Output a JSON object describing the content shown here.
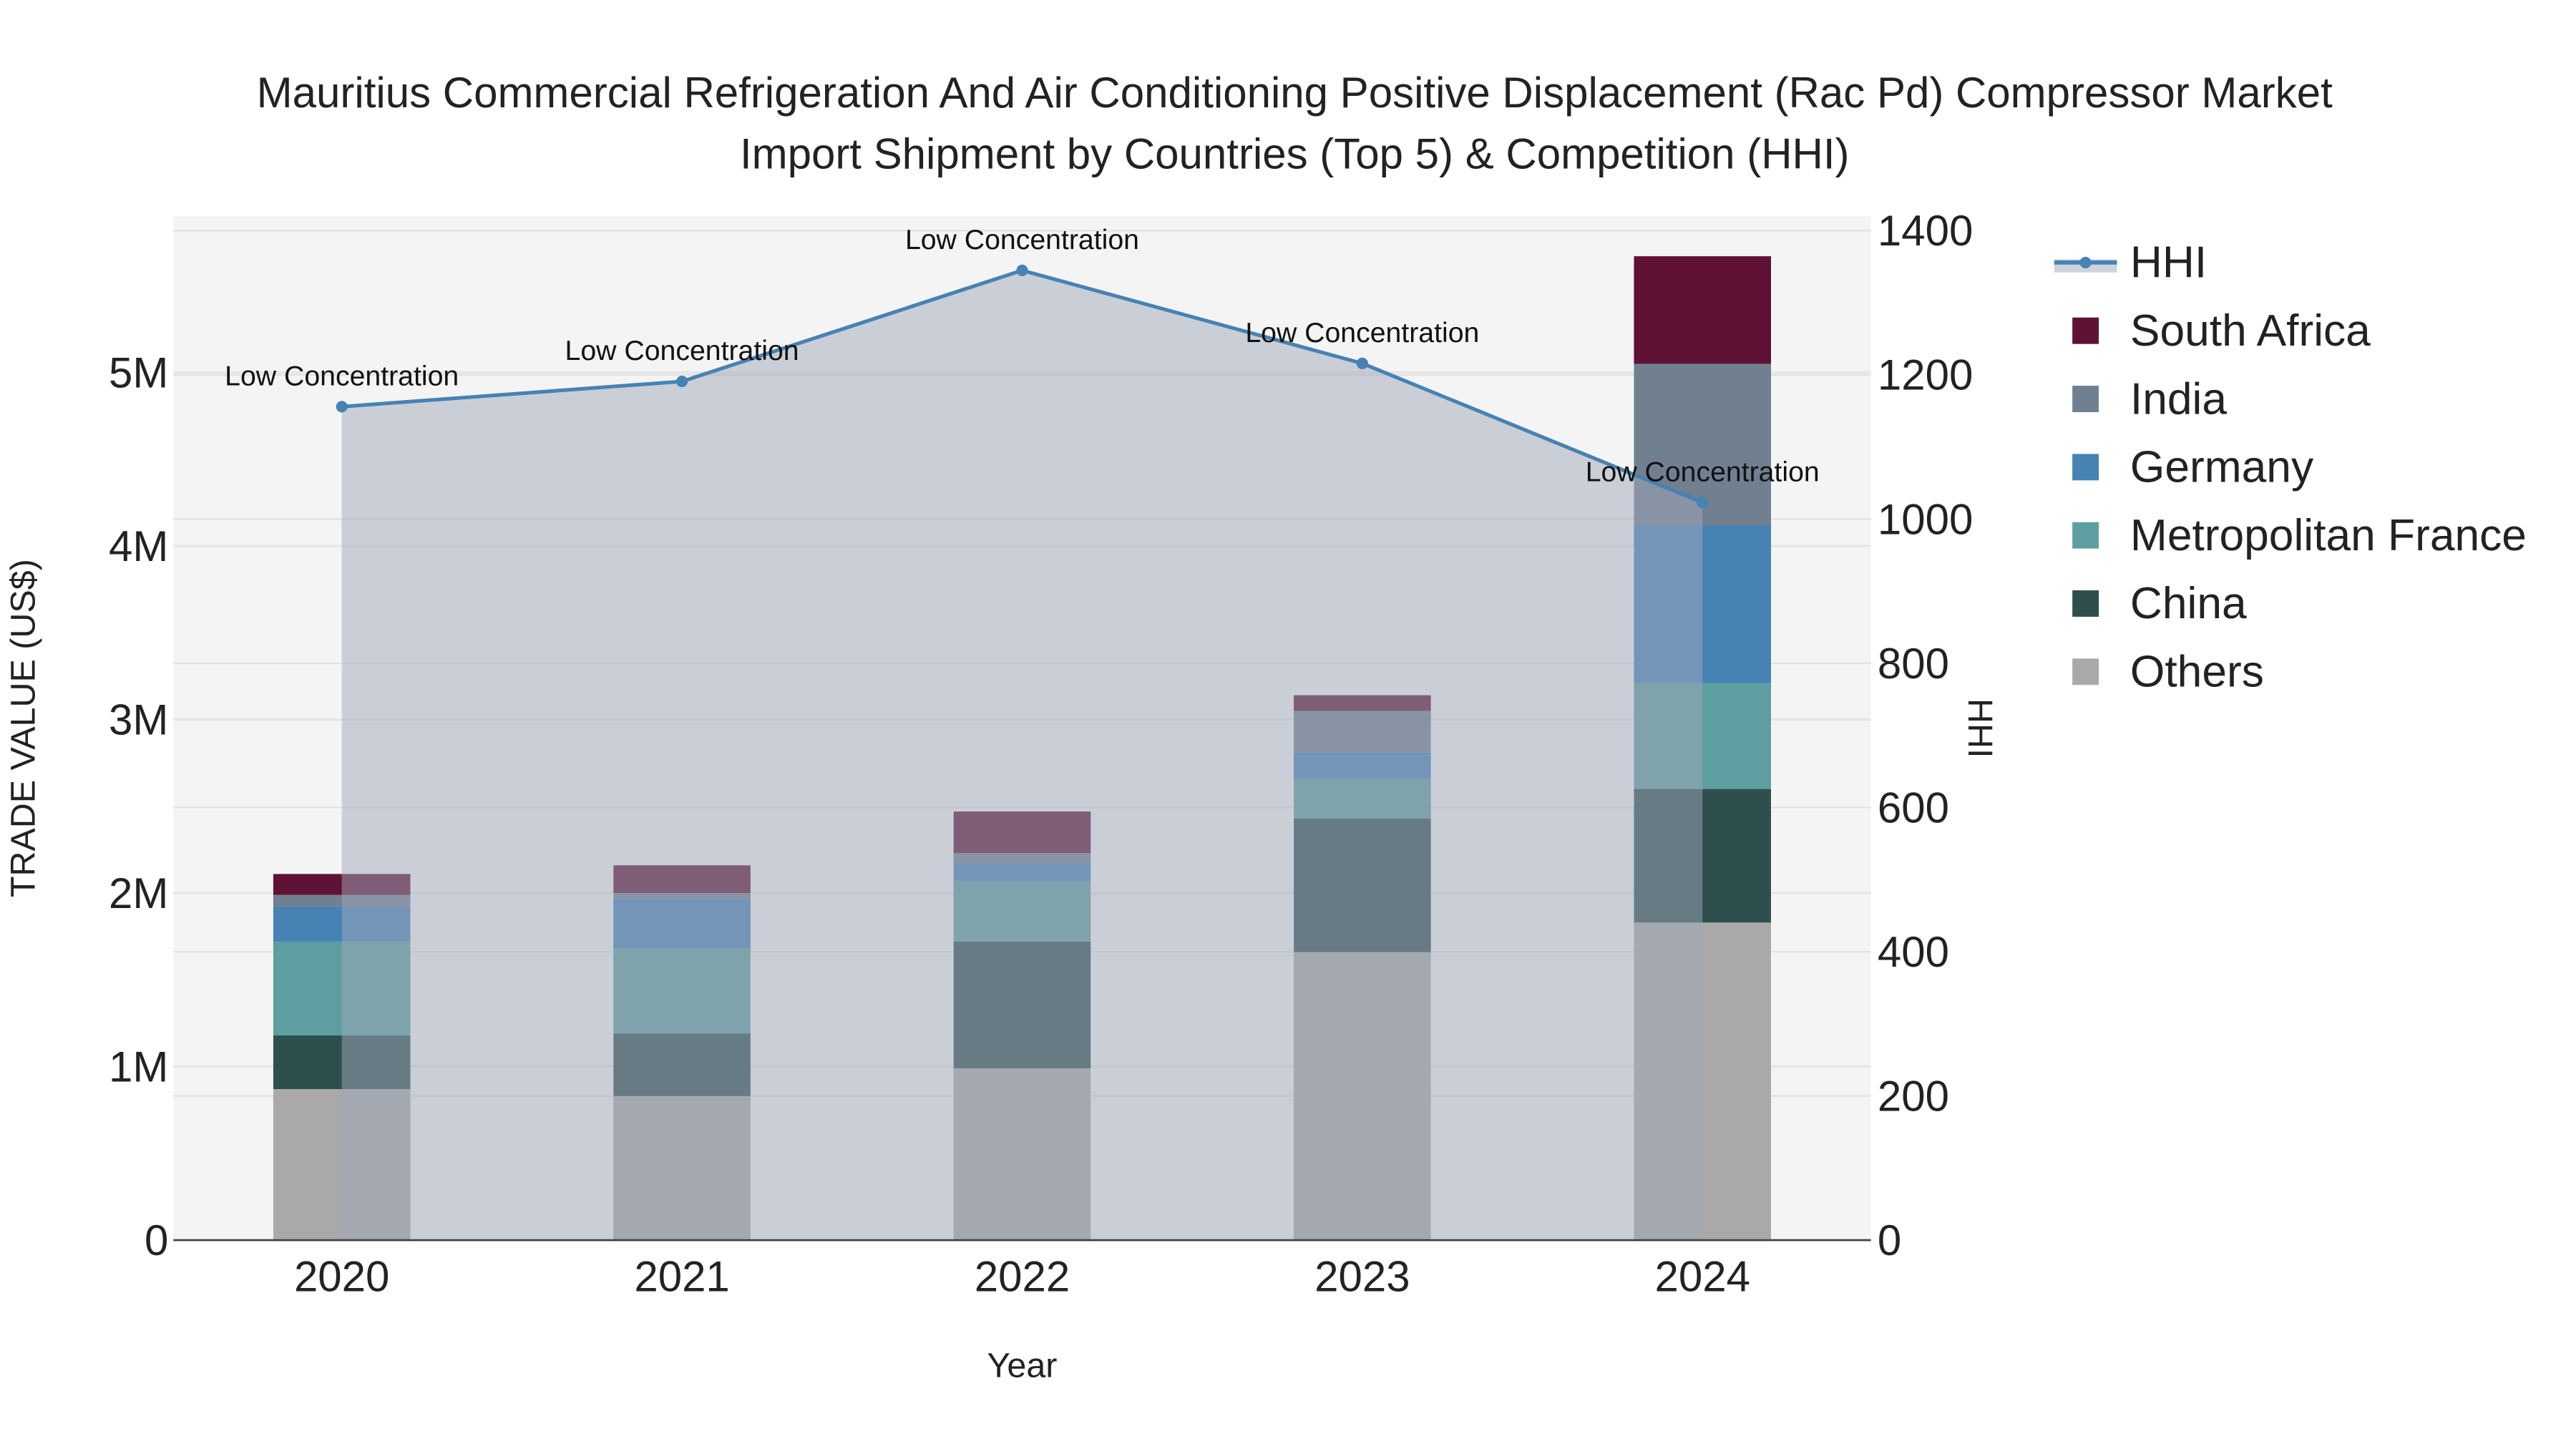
{
  "chart_data": {
    "type": "bar",
    "stacked": true,
    "title_line1": "Mauritius Commercial Refrigeration And Air Conditioning Positive Displacement (Rac Pd) Compressor Market",
    "title_line2": "Import Shipment by Countries (Top 5) & Competition (HHI)",
    "xlabel": "Year",
    "ylabel": "TRADE VALUE (US$)",
    "y2label": "HHI",
    "categories": [
      "2020",
      "2021",
      "2022",
      "2023",
      "2024"
    ],
    "ylim": [
      0,
      5900000
    ],
    "yticks": [
      0,
      1000000,
      2000000,
      3000000,
      4000000,
      5000000
    ],
    "ytick_labels": [
      "0",
      "1M",
      "2M",
      "3M",
      "4M",
      "5M"
    ],
    "y2lim": [
      0,
      1420
    ],
    "y2ticks": [
      0,
      200,
      400,
      600,
      800,
      1000,
      1200,
      1400
    ],
    "y2tick_labels": [
      "0",
      "200",
      "400",
      "600",
      "800",
      "1000",
      "1200",
      "1400"
    ],
    "grid": true,
    "legend_position": "right",
    "series": [
      {
        "name": "Others",
        "color": "#a9a9a9",
        "values": [
          870000,
          830000,
          990000,
          1660000,
          1830000
        ]
      },
      {
        "name": "China",
        "color": "#2f4f4f",
        "values": [
          310000,
          360000,
          730000,
          770000,
          770000
        ]
      },
      {
        "name": "Metropolitan France",
        "color": "#5f9ea0",
        "values": [
          540000,
          490000,
          350000,
          230000,
          610000
        ]
      },
      {
        "name": "Germany",
        "color": "#4682b4",
        "values": [
          200000,
          290000,
          100000,
          150000,
          910000
        ]
      },
      {
        "name": "India",
        "color": "#708090",
        "values": [
          70000,
          30000,
          60000,
          240000,
          930000
        ]
      },
      {
        "name": "South Africa",
        "color": "#5f1235",
        "values": [
          120000,
          160000,
          240000,
          90000,
          620000
        ]
      }
    ],
    "hhi": {
      "name": "HHI",
      "color": "#4682b4",
      "values": [
        1156,
        1191,
        1345,
        1216,
        1023
      ],
      "annotations": [
        "Low Concentration",
        "Low Concentration",
        "Low Concentration",
        "Low Concentration",
        "Low Concentration"
      ]
    },
    "legend_order": [
      "HHI",
      "South Africa",
      "India",
      "Germany",
      "Metropolitan France",
      "China",
      "Others"
    ]
  }
}
